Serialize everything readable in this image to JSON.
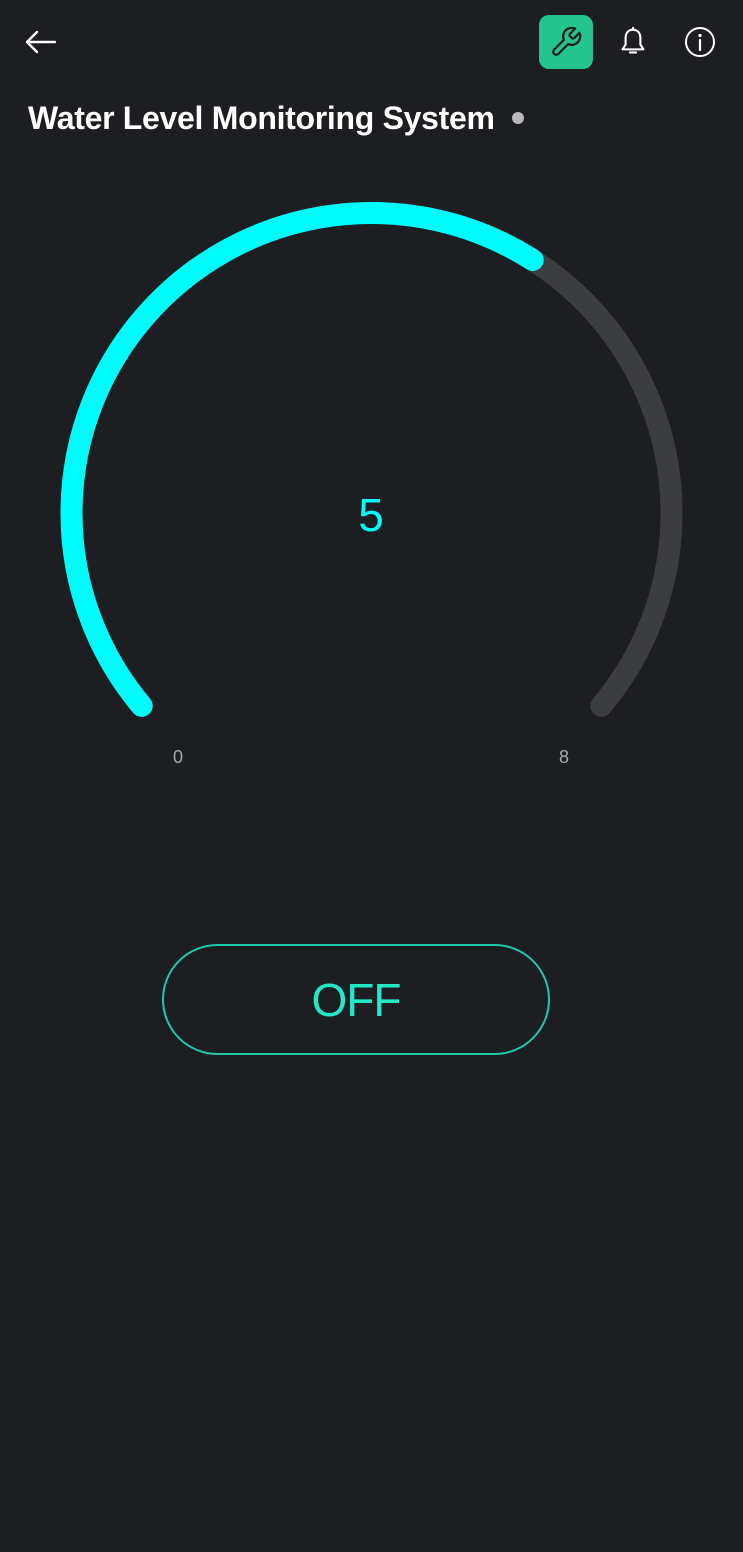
{
  "header": {
    "back_icon": "arrow-left-icon",
    "tools_icon": "wrench-icon",
    "notifications_icon": "bell-icon",
    "info_icon": "info-icon",
    "title": "Water Level Monitoring System",
    "status_icon": "status-dot-icon"
  },
  "gauge": {
    "value": "5",
    "min": "0",
    "max": "8",
    "value_number": 5,
    "min_number": 0,
    "max_number": 8
  },
  "switch": {
    "label": "OFF"
  },
  "colors": {
    "background": "#1d1e21",
    "accent_cyan": "#00fbfb",
    "track_gray": "#3c3d41",
    "brand_green": "#23c48e",
    "switch_text": "#23e8c6",
    "switch_border": "#1fc9aa",
    "status_dot": "#b9b9bd",
    "label_gray": "#a7a9ad"
  }
}
